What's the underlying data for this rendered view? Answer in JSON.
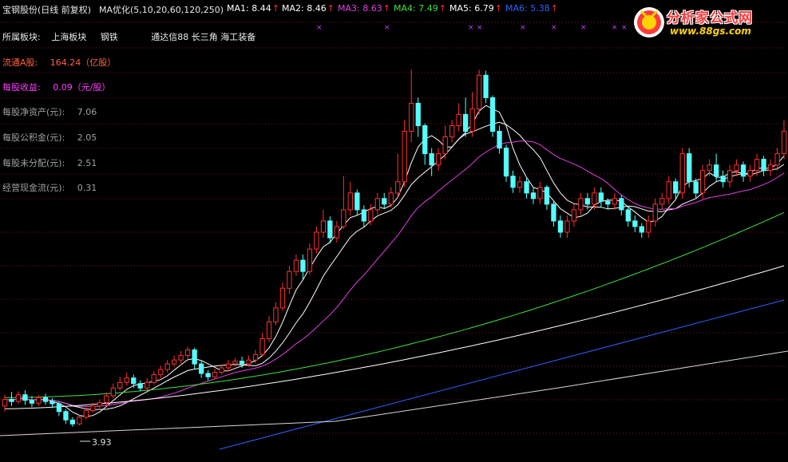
{
  "stock_title": "宝钢股份(日线 前复权)",
  "indicator_name": "MA优化(5,10,20,60,120,250)",
  "ma_readouts": [
    {
      "label": "MA1: 8.44",
      "color": "#ffffff"
    },
    {
      "label": "MA2: 8.46",
      "color": "#ffffff"
    },
    {
      "label": "MA3: 8.63",
      "color": "#e040e0"
    },
    {
      "label": "MA4: 7.49",
      "color": "#40e040"
    },
    {
      "label": "MA5: 6.79",
      "color": "#ffffff"
    },
    {
      "label": "MA6: 5.38",
      "color": "#3060ff"
    }
  ],
  "up_arrow": "↑",
  "sector": {
    "label": "所属板块:",
    "items": [
      "上海板块",
      "钢铁",
      "通达信88 长三角 海工装备"
    ]
  },
  "fundamentals": [
    {
      "label": "流通A股:",
      "value": "164.24（亿股）",
      "label_color": "#ff6040",
      "value_color": "#ff6040"
    },
    {
      "label": "每股收益:",
      "value": "0.09（元/股）",
      "label_color": "#ff40ff",
      "value_color": "#ff40ff"
    },
    {
      "label": "每股净资产(元):",
      "value": "7.06",
      "label_color": "#a0a0a0",
      "value_color": "#a0a0a0"
    },
    {
      "label": "每股公积金(元):",
      "value": "2.05",
      "label_color": "#a0a0a0",
      "value_color": "#a0a0a0"
    },
    {
      "label": "每股未分配(元):",
      "value": "2.51",
      "label_color": "#a0a0a0",
      "value_color": "#a0a0a0"
    },
    {
      "label": "经营现金流(元):",
      "value": "0.31",
      "label_color": "#a0a0a0",
      "value_color": "#a0a0a0"
    }
  ],
  "logo": {
    "name": "分析家公式网",
    "url": "www.88gs.com"
  },
  "low_price_label": "3.93",
  "colors": {
    "background": "#000000",
    "up_candle": "#ff3030",
    "down_candle": "#54ffff",
    "grid": "#7a1818"
  },
  "chart_data": {
    "type": "candlestick",
    "y_range": [
      3.5,
      11.2
    ],
    "grid": true,
    "candles": [
      [
        4.3,
        4.42,
        4.5,
        4.2
      ],
      [
        4.42,
        4.38,
        4.55,
        4.3
      ],
      [
        4.38,
        4.5,
        4.56,
        4.34
      ],
      [
        4.5,
        4.4,
        4.58,
        4.32
      ],
      [
        4.4,
        4.35,
        4.48,
        4.28
      ],
      [
        4.35,
        4.45,
        4.5,
        4.3
      ],
      [
        4.45,
        4.38,
        4.52,
        4.32
      ],
      [
        4.38,
        4.34,
        4.44,
        4.26
      ],
      [
        4.34,
        4.2,
        4.38,
        4.12
      ],
      [
        4.2,
        4.05,
        4.24,
        3.98
      ],
      [
        4.05,
        3.98,
        4.1,
        3.93
      ],
      [
        3.98,
        4.1,
        4.15,
        3.95
      ],
      [
        4.1,
        4.22,
        4.28,
        4.06
      ],
      [
        4.22,
        4.3,
        4.36,
        4.18
      ],
      [
        4.3,
        4.36,
        4.42,
        4.26
      ],
      [
        4.36,
        4.48,
        4.54,
        4.3
      ],
      [
        4.48,
        4.62,
        4.7,
        4.44
      ],
      [
        4.62,
        4.72,
        4.82,
        4.58
      ],
      [
        4.72,
        4.8,
        4.9,
        4.66
      ],
      [
        4.8,
        4.7,
        4.86,
        4.62
      ],
      [
        4.7,
        4.62,
        4.76,
        4.56
      ],
      [
        4.62,
        4.72,
        4.8,
        4.58
      ],
      [
        4.72,
        4.86,
        4.92,
        4.68
      ],
      [
        4.86,
        4.95,
        5.02,
        4.8
      ],
      [
        4.95,
        5.05,
        5.12,
        4.9
      ],
      [
        5.05,
        5.12,
        5.2,
        5.0
      ],
      [
        5.12,
        5.2,
        5.28,
        5.06
      ],
      [
        5.2,
        5.3,
        5.36,
        5.14
      ],
      [
        5.3,
        5.05,
        5.34,
        4.96
      ],
      [
        5.05,
        4.88,
        5.1,
        4.8
      ],
      [
        4.88,
        4.82,
        4.94,
        4.76
      ],
      [
        4.82,
        4.9,
        4.96,
        4.78
      ],
      [
        4.9,
        4.98,
        5.04,
        4.86
      ],
      [
        4.98,
        5.05,
        5.12,
        4.92
      ],
      [
        5.05,
        5.1,
        5.16,
        5.0
      ],
      [
        5.1,
        5.05,
        5.18,
        4.98
      ],
      [
        5.05,
        5.12,
        5.2,
        5.0
      ],
      [
        5.12,
        5.22,
        5.3,
        5.06
      ],
      [
        5.22,
        5.5,
        5.6,
        5.18
      ],
      [
        5.5,
        5.8,
        5.9,
        5.44
      ],
      [
        5.8,
        6.05,
        6.15,
        5.74
      ],
      [
        6.05,
        6.4,
        6.5,
        6.0
      ],
      [
        6.4,
        6.7,
        6.8,
        6.3
      ],
      [
        6.7,
        6.9,
        7.0,
        6.62
      ],
      [
        6.9,
        6.7,
        7.0,
        6.56
      ],
      [
        6.7,
        7.1,
        7.2,
        6.64
      ],
      [
        7.1,
        7.4,
        7.5,
        7.02
      ],
      [
        7.4,
        7.6,
        7.8,
        7.3
      ],
      [
        7.6,
        7.3,
        7.68,
        7.2
      ],
      [
        7.3,
        7.5,
        7.6,
        7.22
      ],
      [
        7.5,
        7.8,
        8.4,
        7.46
      ],
      [
        7.8,
        8.1,
        8.3,
        7.7
      ],
      [
        8.1,
        7.8,
        8.16,
        7.7
      ],
      [
        7.8,
        7.6,
        7.88,
        7.5
      ],
      [
        7.6,
        7.8,
        7.9,
        7.52
      ],
      [
        7.8,
        8.0,
        8.1,
        7.72
      ],
      [
        8.0,
        7.9,
        8.1,
        7.82
      ],
      [
        7.9,
        8.1,
        8.2,
        7.84
      ],
      [
        8.1,
        8.3,
        8.8,
        8.02
      ],
      [
        8.3,
        9.2,
        9.4,
        8.2
      ],
      [
        9.2,
        9.7,
        10.3,
        9.0
      ],
      [
        9.7,
        9.3,
        9.8,
        9.1
      ],
      [
        9.3,
        8.8,
        9.34,
        8.6
      ],
      [
        8.8,
        8.6,
        8.9,
        8.4
      ],
      [
        8.6,
        8.8,
        8.9,
        8.5
      ],
      [
        8.8,
        9.1,
        9.3,
        8.7
      ],
      [
        9.1,
        9.3,
        9.4,
        9.0
      ],
      [
        9.3,
        9.5,
        9.7,
        9.2
      ],
      [
        9.5,
        9.2,
        9.8,
        9.1
      ],
      [
        9.2,
        9.6,
        9.9,
        9.1
      ],
      [
        9.6,
        10.2,
        10.3,
        9.5
      ],
      [
        10.2,
        9.8,
        10.28,
        9.7
      ],
      [
        9.8,
        9.2,
        9.84,
        9.1
      ],
      [
        9.2,
        8.9,
        9.3,
        8.8
      ],
      [
        8.9,
        8.4,
        8.96,
        8.3
      ],
      [
        8.4,
        8.2,
        8.5,
        8.1
      ],
      [
        8.2,
        8.3,
        8.4,
        8.1
      ],
      [
        8.3,
        8.1,
        8.36,
        8.0
      ],
      [
        8.1,
        8.0,
        8.2,
        7.9
      ],
      [
        8.0,
        8.2,
        8.3,
        7.9
      ],
      [
        8.2,
        7.9,
        8.24,
        7.8
      ],
      [
        7.9,
        7.6,
        7.96,
        7.5
      ],
      [
        7.6,
        7.4,
        7.7,
        7.3
      ],
      [
        7.4,
        7.6,
        7.7,
        7.3
      ],
      [
        7.6,
        7.8,
        7.9,
        7.5
      ],
      [
        7.8,
        8.0,
        8.1,
        7.7
      ],
      [
        8.0,
        7.9,
        8.1,
        7.8
      ],
      [
        7.9,
        8.1,
        8.2,
        7.8
      ],
      [
        8.1,
        7.95,
        8.2,
        7.85
      ],
      [
        7.95,
        7.9,
        8.0,
        7.8
      ],
      [
        7.9,
        8.0,
        8.1,
        7.8
      ],
      [
        8.0,
        7.8,
        8.06,
        7.7
      ],
      [
        7.8,
        7.6,
        7.86,
        7.5
      ],
      [
        7.6,
        7.5,
        7.7,
        7.4
      ],
      [
        7.5,
        7.4,
        7.56,
        7.3
      ],
      [
        7.4,
        7.6,
        7.7,
        7.3
      ],
      [
        7.6,
        7.9,
        8.0,
        7.5
      ],
      [
        7.9,
        8.0,
        8.1,
        7.8
      ],
      [
        8.0,
        8.3,
        8.4,
        7.9
      ],
      [
        8.3,
        8.1,
        8.36,
        8.0
      ],
      [
        8.1,
        8.8,
        8.9,
        8.0
      ],
      [
        8.8,
        8.3,
        8.9,
        8.2
      ],
      [
        8.3,
        8.1,
        8.36,
        8.0
      ],
      [
        8.1,
        8.5,
        8.6,
        8.0
      ],
      [
        8.5,
        8.6,
        8.7,
        8.4
      ],
      [
        8.6,
        8.4,
        8.8,
        8.3
      ],
      [
        8.4,
        8.3,
        8.5,
        8.2
      ],
      [
        8.3,
        8.5,
        8.6,
        8.2
      ],
      [
        8.5,
        8.6,
        8.7,
        8.4
      ],
      [
        8.6,
        8.4,
        8.66,
        8.3
      ],
      [
        8.4,
        8.5,
        8.6,
        8.3
      ],
      [
        8.5,
        8.7,
        8.8,
        8.4
      ],
      [
        8.7,
        8.5,
        8.76,
        8.4
      ],
      [
        8.5,
        8.6,
        8.7,
        8.4
      ],
      [
        8.6,
        8.8,
        8.9,
        8.5
      ],
      [
        8.8,
        9.2,
        9.4,
        8.7
      ]
    ],
    "ma_periods": {
      "MA1": 5,
      "MA2": 10,
      "MA3": 20,
      "MA4": 60,
      "MA5": 120,
      "MA6": 250
    }
  }
}
